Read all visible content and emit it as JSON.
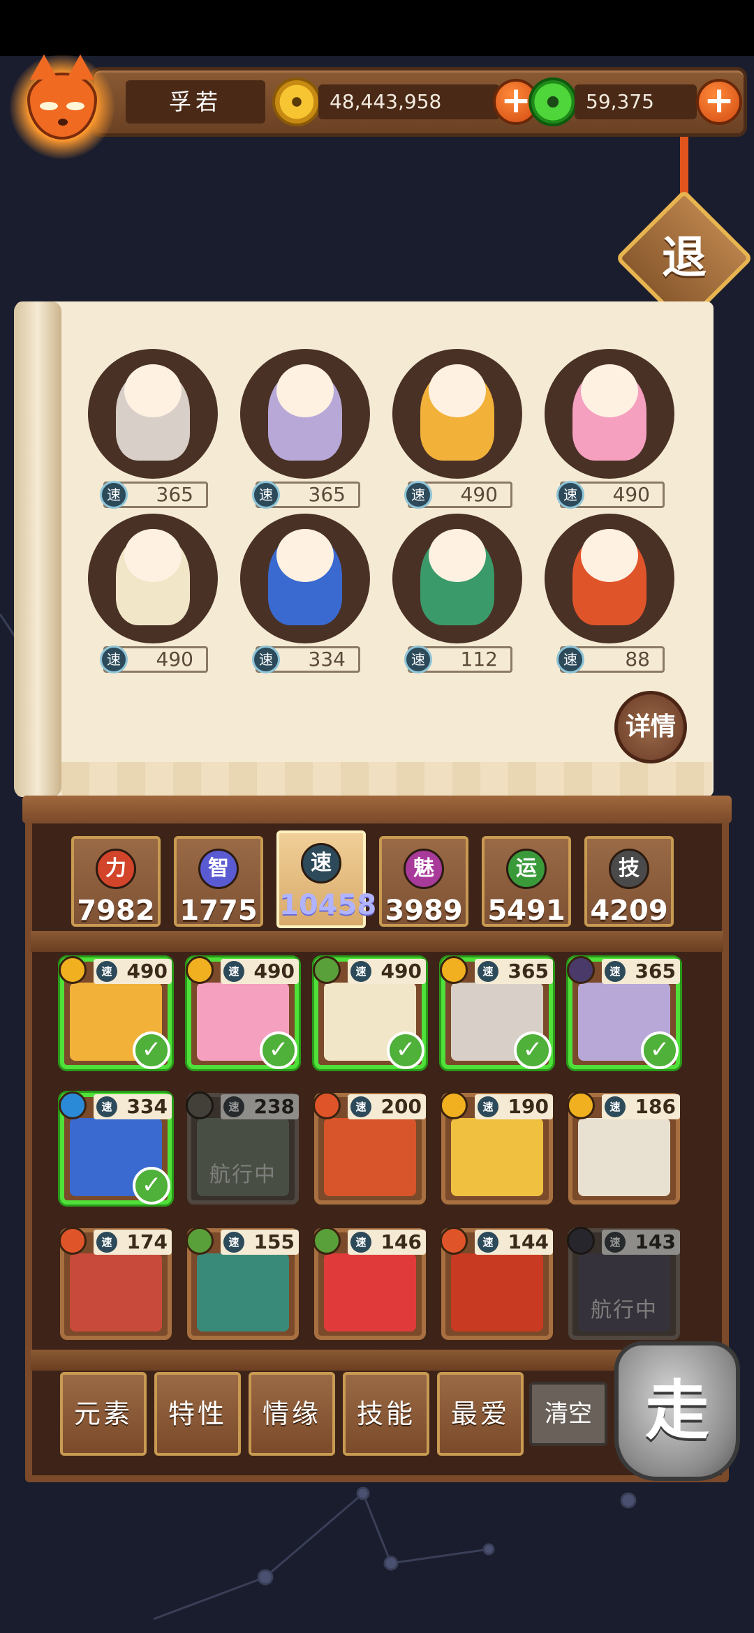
{
  "player": {
    "name": "孚若"
  },
  "resources": {
    "gold": {
      "icon": "gold-coin-icon",
      "value": "48,443,958"
    },
    "jade": {
      "icon": "jade-coin-icon",
      "value": "59,375"
    }
  },
  "exit_label": "退",
  "speed_label": "速",
  "team": [
    {
      "speed": "365",
      "palette": "#d8d0c8"
    },
    {
      "speed": "365",
      "palette": "#b8a8d8"
    },
    {
      "speed": "490",
      "palette": "#f2b23a"
    },
    {
      "speed": "490",
      "palette": "#f6a0c0"
    },
    {
      "speed": "490",
      "palette": "#f2e6c8"
    },
    {
      "speed": "334",
      "palette": "#3a6ad0"
    },
    {
      "speed": "112",
      "palette": "#3a9a6a"
    },
    {
      "speed": "88",
      "palette": "#e0542a"
    }
  ],
  "detail_label": "详情",
  "attributes": [
    {
      "icon": "力",
      "value": "7982",
      "color": "#d2452a",
      "active": false
    },
    {
      "icon": "智",
      "value": "1775",
      "color": "#5a5ad2",
      "active": false
    },
    {
      "icon": "速",
      "value": "10458",
      "color": "#2c4a5a",
      "active": true
    },
    {
      "icon": "魅",
      "value": "3989",
      "color": "#a83a9a",
      "active": false
    },
    {
      "icon": "运",
      "value": "5491",
      "color": "#3a9a3a",
      "active": false
    },
    {
      "icon": "技",
      "value": "4209",
      "color": "#4a4a4a",
      "active": false
    }
  ],
  "roster": [
    {
      "speed": "490",
      "element": "gold",
      "selected": true,
      "busy": false,
      "art": "#f2b23a"
    },
    {
      "speed": "490",
      "element": "gold",
      "selected": true,
      "busy": false,
      "art": "#f6a0c0"
    },
    {
      "speed": "490",
      "element": "wood",
      "selected": true,
      "busy": false,
      "art": "#f2e6c8"
    },
    {
      "speed": "365",
      "element": "gold",
      "selected": true,
      "busy": false,
      "art": "#d8d0c8"
    },
    {
      "speed": "365",
      "element": "dark",
      "selected": true,
      "busy": false,
      "art": "#b8a8d8"
    },
    {
      "speed": "334",
      "element": "water",
      "selected": true,
      "busy": false,
      "art": "#3a6ad0"
    },
    {
      "speed": "238",
      "element": "earth",
      "selected": false,
      "busy": true,
      "art": "#6a8a4a"
    },
    {
      "speed": "200",
      "element": "fire",
      "selected": false,
      "busy": false,
      "art": "#d8542a"
    },
    {
      "speed": "190",
      "element": "gold",
      "selected": false,
      "busy": false,
      "art": "#f0c040"
    },
    {
      "speed": "186",
      "element": "gold",
      "selected": false,
      "busy": false,
      "art": "#e8e0d0"
    },
    {
      "speed": "174",
      "element": "fire",
      "selected": false,
      "busy": false,
      "art": "#c84a3a"
    },
    {
      "speed": "155",
      "element": "wood",
      "selected": false,
      "busy": false,
      "art": "#3a8a7a"
    },
    {
      "speed": "146",
      "element": "wood",
      "selected": false,
      "busy": false,
      "art": "#e03a3a"
    },
    {
      "speed": "144",
      "element": "fire",
      "selected": false,
      "busy": false,
      "art": "#c83a22"
    },
    {
      "speed": "143",
      "element": "dark",
      "selected": false,
      "busy": true,
      "art": "#6a4a8a"
    }
  ],
  "busy_label": "航行中",
  "filters": [
    "元素",
    "特性",
    "情缘",
    "技能",
    "最爱"
  ],
  "clear_label": "清空",
  "go_label": "走",
  "element_colors": {
    "gold": "#f0b020",
    "wood": "#5aa03a",
    "fire": "#e0542a",
    "water": "#2a8ad8",
    "dark": "#4a3a6a",
    "earth": "#7a6a3a"
  }
}
